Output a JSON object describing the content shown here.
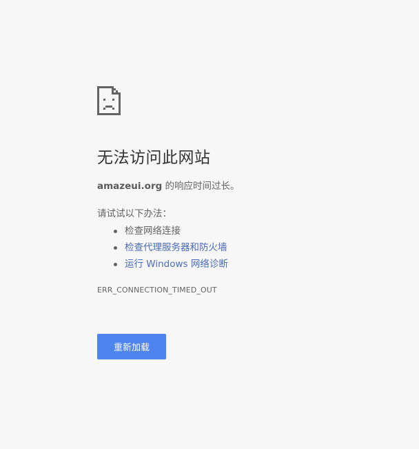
{
  "error_page": {
    "icon": "sad-page-icon",
    "title": "无法访问此网站",
    "site": "amazeui.org",
    "description_suffix": " 的响应时间过长。",
    "suggest_title": "请试试以下办法：",
    "suggestions": [
      {
        "label": "检查网络连接",
        "is_link": false
      },
      {
        "label": "检查代理服务器和防火墙",
        "is_link": true
      },
      {
        "label": "运行 Windows 网络诊断",
        "is_link": true
      }
    ],
    "error_code": "ERR_CONNECTION_TIMED_OUT",
    "reload_button_label": "重新加载"
  },
  "colors": {
    "background": "#f7f7f7",
    "title": "#333333",
    "body_text": "#646464",
    "link": "#4a6cba",
    "button": "#4d84f0",
    "button_text": "#ffffff"
  }
}
